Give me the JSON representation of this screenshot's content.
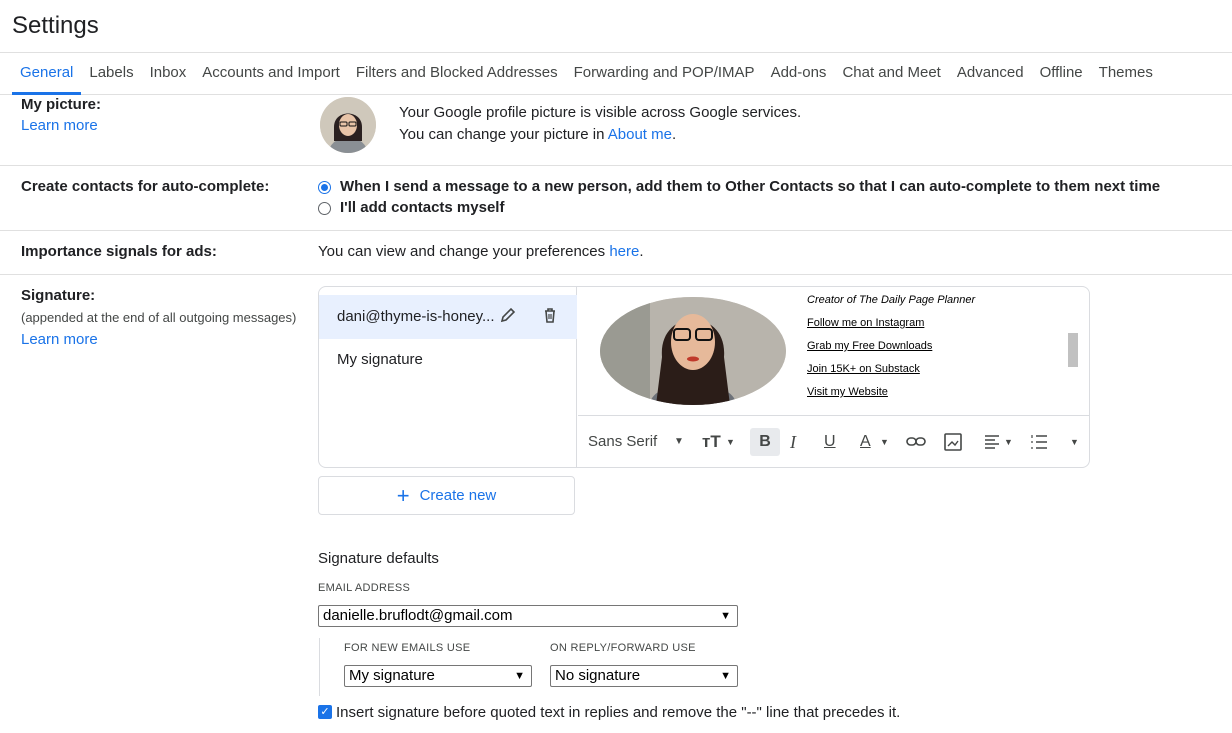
{
  "title": "Settings",
  "tabs": [
    "General",
    "Labels",
    "Inbox",
    "Accounts and Import",
    "Filters and Blocked Addresses",
    "Forwarding and POP/IMAP",
    "Add-ons",
    "Chat and Meet",
    "Advanced",
    "Offline",
    "Themes"
  ],
  "picture": {
    "label": "My picture:",
    "learn_more": "Learn more",
    "line1": "Your Google profile picture is visible across Google services.",
    "line2_prefix": "You can change your picture in ",
    "line2_link": "About me",
    "line2_suffix": "."
  },
  "contacts": {
    "label": "Create contacts for auto-complete:",
    "option1": "When I send a message to a new person, add them to Other Contacts so that I can auto-complete to them next time",
    "option2": "I'll add contacts myself"
  },
  "importance": {
    "label": "Importance signals for ads:",
    "text": "You can view and change your preferences ",
    "link": "here",
    "suffix": "."
  },
  "signature": {
    "label": "Signature:",
    "sub": "(appended at the end of all outgoing messages)",
    "learn_more": "Learn more",
    "selected_name": "dani@thyme-is-honey...",
    "other_name": "My signature",
    "preview": {
      "caption": "Creator of The Daily Page Planner",
      "links": [
        "Follow me on Instagram",
        "Grab my Free Downloads",
        "Join 15K+ on Substack",
        "Visit my Website"
      ]
    },
    "font": "Sans Serif",
    "create_new": "Create new"
  },
  "defaults": {
    "heading": "Signature defaults",
    "email_label": "EMAIL ADDRESS",
    "email_value": "danielle.bruflodt@gmail.com",
    "new_label": "FOR NEW EMAILS USE",
    "new_value": "My signature",
    "reply_label": "ON REPLY/FORWARD USE",
    "reply_value": "No signature",
    "insert_text": "Insert signature before quoted text in replies and remove the \"--\" line that precedes it."
  }
}
